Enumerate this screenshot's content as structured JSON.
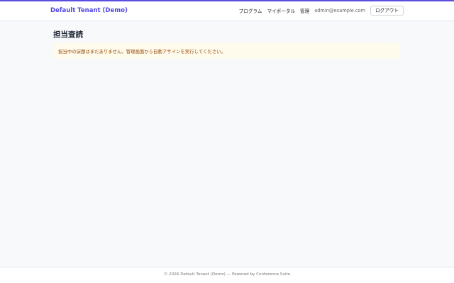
{
  "header": {
    "brand": "Default Tenant (Demo)",
    "nav": {
      "programs": "プログラム",
      "mypage": "マイポータル",
      "admin": "管理"
    },
    "user_email": "admin@example.com",
    "logout_label": "ログアウト"
  },
  "main": {
    "title": "担当査読",
    "notice": "担当中の演題はまだありません。管理画面から自動アサインを実行してください。"
  },
  "footer": {
    "text": "© 2026 Default Tenant (Demo) — Powered by Conference Suite"
  },
  "colors": {
    "accent": "#4f46e5",
    "notice_bg": "#fefbec",
    "notice_text": "#9a4f0f"
  }
}
